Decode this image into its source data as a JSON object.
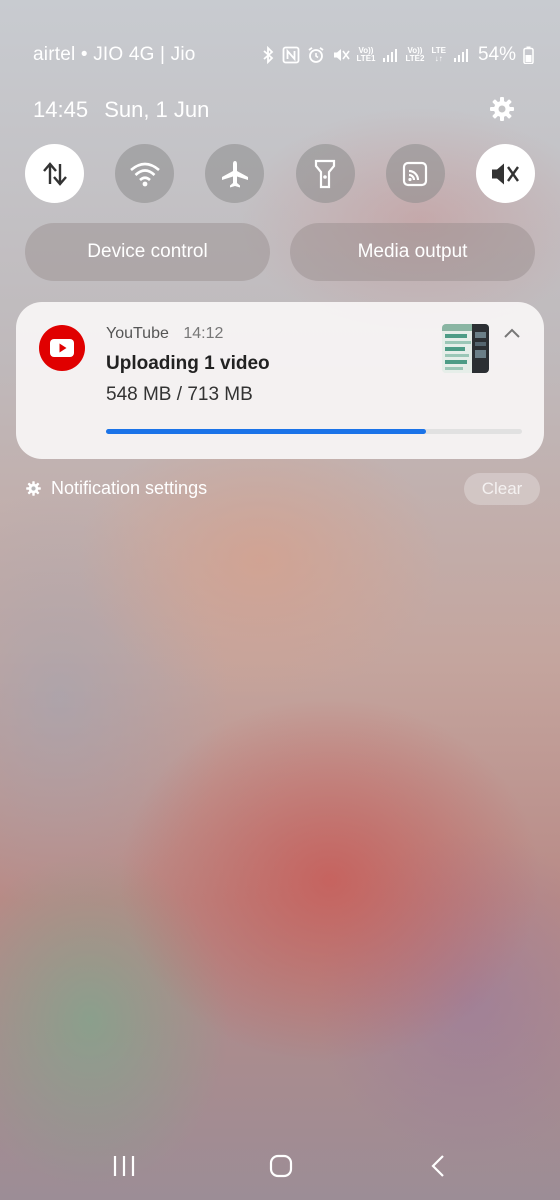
{
  "status_bar": {
    "carrier": "airtel • JIO 4G | Jio",
    "sim1_label_top": "Vo))",
    "sim1_label_bottom": "LTE1",
    "sim2_label_top": "Vo))",
    "sim2_label_bottom": "LTE2",
    "data_label": "LTE",
    "battery": "54%",
    "icons": [
      "bluetooth-icon",
      "nfc-icon",
      "alarm-icon",
      "mute-icon",
      "signal-icon",
      "signal-icon",
      "battery-icon"
    ]
  },
  "header": {
    "time": "14:45",
    "date": "Sun, 1 Jun",
    "settings_icon": "gear-icon"
  },
  "quick_settings": [
    {
      "name": "mobile-data",
      "icon": "updown-arrows-icon",
      "state": "on"
    },
    {
      "name": "wifi",
      "icon": "wifi-icon",
      "state": "off"
    },
    {
      "name": "airplane",
      "icon": "airplane-icon",
      "state": "off"
    },
    {
      "name": "flashlight",
      "icon": "flashlight-icon",
      "state": "off"
    },
    {
      "name": "cast",
      "icon": "cast-icon",
      "state": "off"
    },
    {
      "name": "sound",
      "icon": "mute-icon",
      "state": "on"
    }
  ],
  "pills": {
    "device_control": "Device control",
    "media_output": "Media output"
  },
  "notification": {
    "app": "YouTube",
    "time": "14:12",
    "title": "Uploading 1 video",
    "subtitle": "548 MB / 713 MB",
    "progress": 0.77,
    "accent": "#1a73e8",
    "app_color": "#e00000"
  },
  "footer": {
    "settings_label": "Notification settings",
    "clear_label": "Clear"
  },
  "navbar": [
    "recents-icon",
    "home-icon",
    "back-icon"
  ]
}
